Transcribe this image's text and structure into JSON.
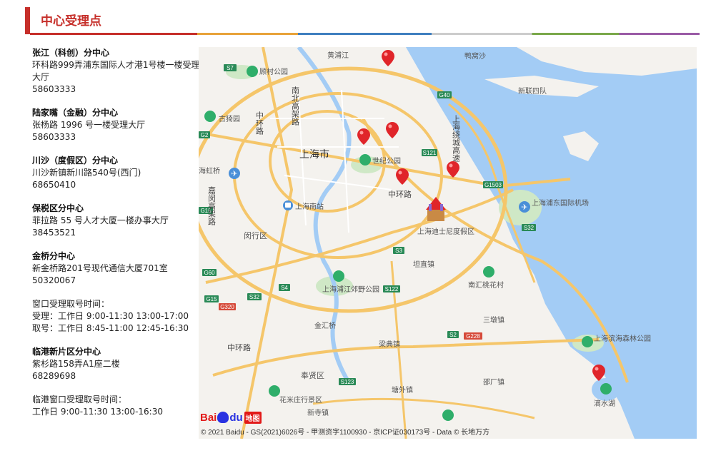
{
  "header": {
    "title": "中心受理点",
    "accent_color": "#c62f2a",
    "line_colors": [
      "#c62f2a",
      "#e8a33a",
      "#3f7fbf",
      "#7aa84a",
      "#9a5ba6"
    ]
  },
  "centers": [
    {
      "name": "张江（科创）分中心",
      "address": "环科路999弄浦东国际人才港1号楼一楼受理大厅",
      "phone": "58603333"
    },
    {
      "name": "陆家嘴（金融）分中心",
      "address": "张杨路 1996 号一楼受理大厅",
      "phone": "58603333"
    },
    {
      "name": "川沙（度假区）分中心",
      "address": "川沙新镇新川路540号(西门)",
      "phone": "68650410"
    },
    {
      "name": "保税区分中心",
      "address": "菲拉路 55 号人才大厦一楼办事大厅",
      "phone": "38453521"
    },
    {
      "name": "金桥分中心",
      "address": "新金桥路201号现代通信大厦701室",
      "phone": "50320067"
    }
  ],
  "hours_note": {
    "title": "窗口受理取号时间：",
    "accept": "受理：工作日 9:00-11:30 13:00-17:00",
    "ticket": "取号：工作日 8:45-11:00 12:45-16:30"
  },
  "lingang": {
    "name": "临港新片区分中心",
    "address": "紫杉路158弄A1座二楼",
    "phone": "68289698"
  },
  "lingang_note": {
    "title": "临港窗口受理取号时间：",
    "hours": "工作日 9:00-11:30 13:00-16:30"
  },
  "map": {
    "labels": {
      "city": "上海市",
      "huangpu": "黄浦江",
      "yachuansha": "鸭窝沙",
      "xincun": "新联四队",
      "gucun": "顾村公园",
      "nanbei": "南北高架路",
      "zhonghuan": "中环路",
      "zhonghuan2": "中环路",
      "zhonghuan3": "中环路",
      "guyi": "古猗园",
      "hongqiao": "海虹桥",
      "jiamin": "嘉闵高架路",
      "shiji": "世纪公园",
      "huancheng": "上海绕城高速",
      "pudong_airport": "上海浦东国际机场",
      "south_station": "上海南站",
      "disney": "上海迪士尼度假区",
      "minhang": "闵行区",
      "kangqiao": "坦直镇",
      "taohua": "南汇桃花村",
      "pujiang": "上海浦江郊野公园",
      "jinhui": "金汇桥",
      "sandun": "三墩镇",
      "binhai": "上海滨海森林公园",
      "fengxian": "奉贤区",
      "liangdian": "梁典镇",
      "tangwai": "塘外镇",
      "zhaogang": "邵厂镇",
      "huami": "花米庄行景区",
      "xinsi": "新寺镇",
      "dishui": "滴水湖"
    },
    "highway_badges": {
      "s7": "S7",
      "g40": "G40",
      "g2": "G2",
      "s121": "S121",
      "g1503": "G1503",
      "s32a": "S32",
      "s32b": "S32",
      "g15a": "G15",
      "g15b": "G15",
      "s3": "S3",
      "s4": "S4",
      "g60": "G60",
      "s122": "S122",
      "g320": "G320",
      "s2": "S2",
      "g228": "G228",
      "s123": "S123"
    },
    "logo": {
      "bai": "Bai",
      "du": "du",
      "tag": "地图"
    },
    "copyright": "© 2021 Baidu - GS(2021)6026号 - 甲测资字1100930 - 京ICP证030173号 - Data © 长地万方",
    "colors": {
      "water": "#a3ccf5",
      "land": "#f4f2ee",
      "park": "#cfe8c6",
      "road": "#f5c66a",
      "ring": "#ffffff",
      "pin": "#e0252a"
    }
  }
}
